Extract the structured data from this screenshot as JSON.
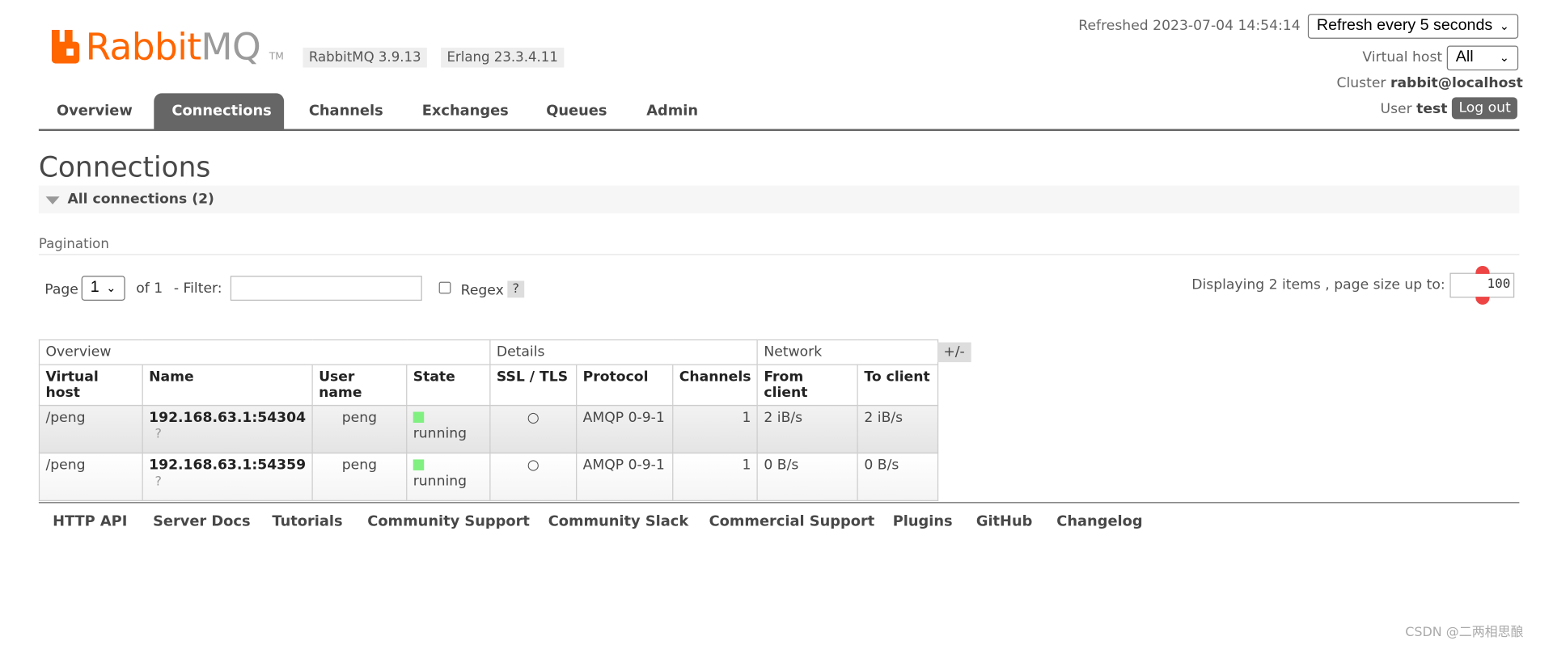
{
  "brand": {
    "logo_text_rabbit": "Rabbit",
    "logo_text_mq": "MQ",
    "tm": "TM",
    "color_orange": "#ff6600"
  },
  "versions": {
    "rabbitmq": "RabbitMQ 3.9.13",
    "erlang": "Erlang 23.3.4.11"
  },
  "header": {
    "refreshed_label": "Refreshed 2023-07-04 14:54:14",
    "refresh_select": "Refresh every 5 seconds",
    "vhost_label": "Virtual host",
    "vhost_select": "All",
    "cluster_label": "Cluster",
    "cluster_value": "rabbit@localhost",
    "user_label": "User",
    "user_value": "test",
    "logout": "Log out"
  },
  "nav": {
    "tabs": [
      "Overview",
      "Connections",
      "Channels",
      "Exchanges",
      "Queues",
      "Admin"
    ],
    "active": "Connections"
  },
  "page": {
    "title": "Connections",
    "section": "All connections (2)"
  },
  "pagination": {
    "label": "Pagination",
    "page_label": "Page",
    "page_value": "1",
    "of_label": "of 1",
    "filter_label": "- Filter:",
    "filter_value": "",
    "regex_label": "Regex",
    "help": "?",
    "displaying": "Displaying 2 items , page size up to:",
    "page_size": "100"
  },
  "table": {
    "groups": [
      "Overview",
      "Details",
      "Network"
    ],
    "columns": [
      "Virtual host",
      "Name",
      "User name",
      "State",
      "SSL / TLS",
      "Protocol",
      "Channels",
      "From client",
      "To client"
    ],
    "rows": [
      {
        "vhost": "/peng",
        "name": "192.168.63.1:54304",
        "user": "peng",
        "state": "running",
        "ssl": "○",
        "protocol": "AMQP 0-9-1",
        "channels": "1",
        "from_client": "2 iB/s",
        "to_client": "2 iB/s",
        "q": "?"
      },
      {
        "vhost": "/peng",
        "name": "192.168.63.1:54359",
        "user": "peng",
        "state": "running",
        "ssl": "○",
        "protocol": "AMQP 0-9-1",
        "channels": "1",
        "from_client": "0 B/s",
        "to_client": "0 B/s",
        "q": "?"
      }
    ],
    "plus_minus": "+/-"
  },
  "footer": {
    "links": [
      "HTTP API",
      "Server Docs",
      "Tutorials",
      "Community Support",
      "Community Slack",
      "Commercial Support",
      "Plugins",
      "GitHub",
      "Changelog"
    ]
  },
  "watermark": "CSDN @二两相思酿"
}
